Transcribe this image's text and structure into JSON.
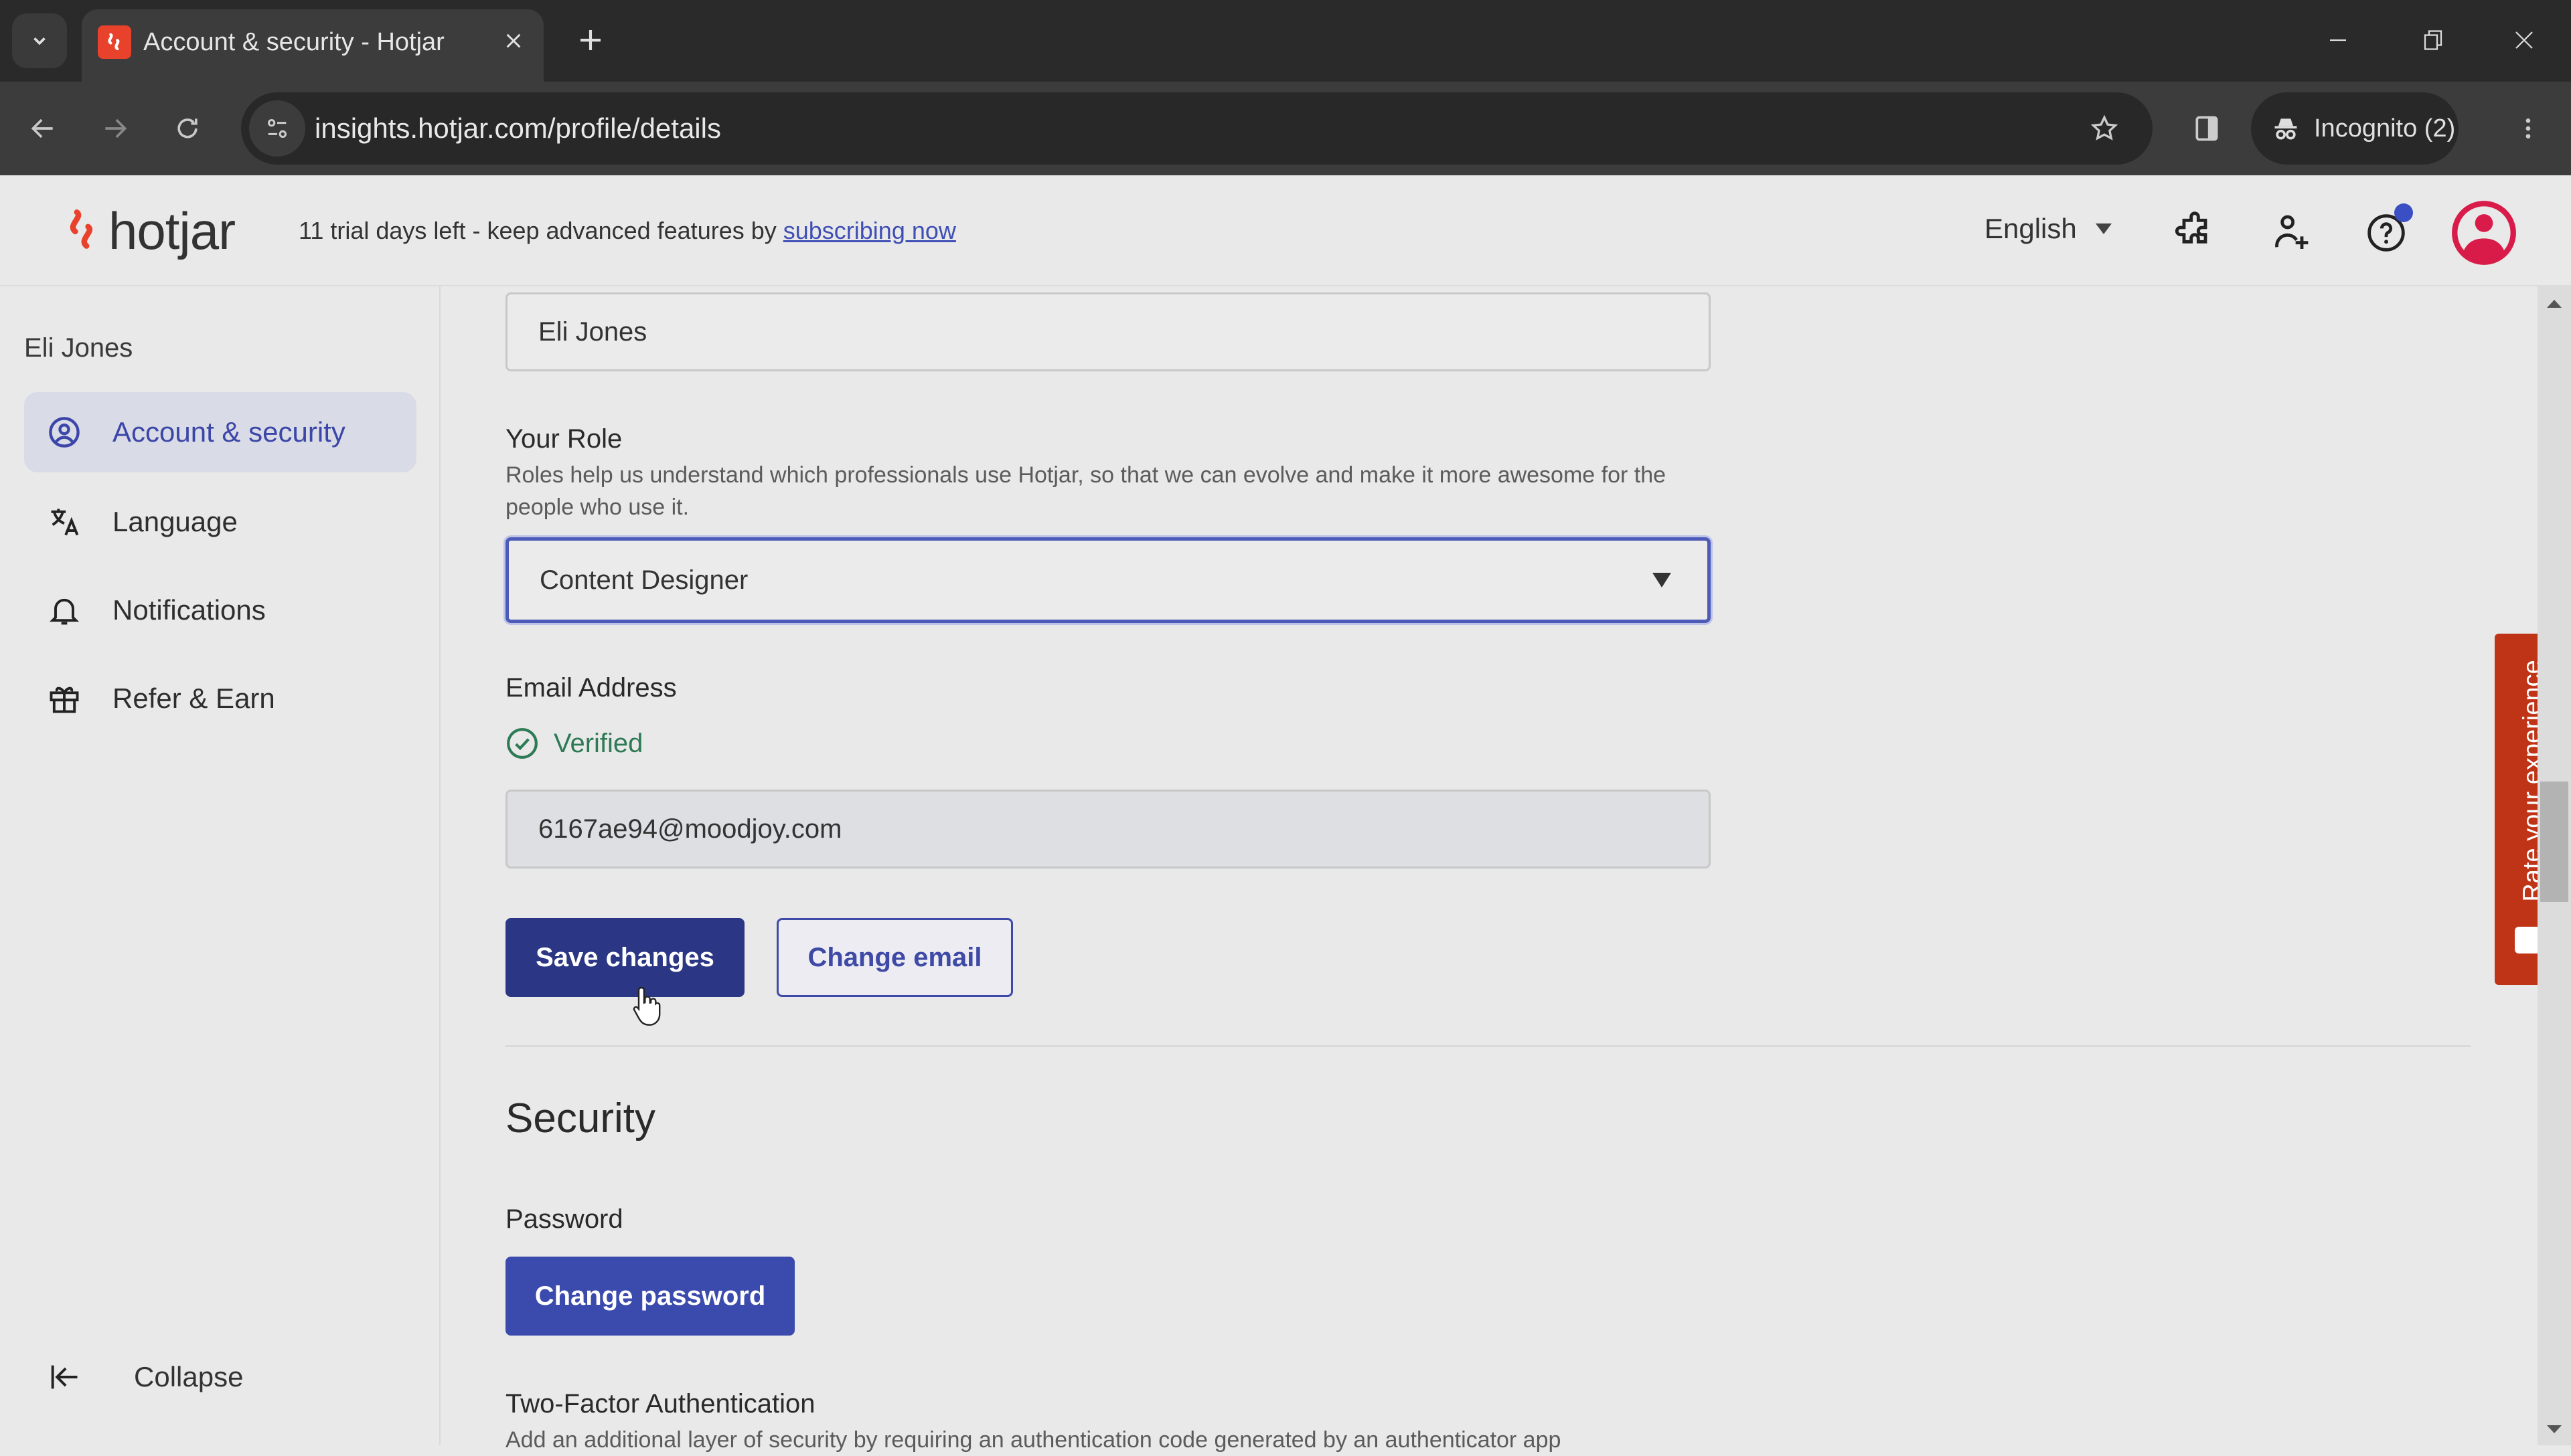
{
  "browser": {
    "tab_title": "Account & security - Hotjar",
    "url": "insights.hotjar.com/profile/details",
    "incognito_label": "Incognito (2)",
    "icons": {
      "tab_search": "chevron-down-icon",
      "favicon": "hotjar-logo-icon",
      "close_tab": "close-icon",
      "new_tab": "plus-icon",
      "back": "arrow-left-icon",
      "forward": "arrow-right-icon",
      "reload": "reload-icon",
      "site_info": "tune-icon",
      "bookmark": "star-icon",
      "side_panel": "side-panel-icon",
      "incognito": "incognito-icon",
      "menu": "more-vertical-icon",
      "minimize": "minimize-icon",
      "restore": "restore-icon",
      "close_window": "close-icon"
    }
  },
  "header": {
    "logo_text": "hotjar",
    "trial_text": "11 trial days left - keep advanced features by ",
    "trial_link": "subscribing now",
    "language": "English",
    "icons": [
      "puzzle-icon",
      "add-user-icon",
      "help-icon",
      "avatar-icon"
    ],
    "help_has_notification": true
  },
  "sidebar": {
    "user_name": "Eli Jones",
    "items": [
      {
        "label": "Account & security",
        "icon": "user-circle-icon",
        "active": true
      },
      {
        "label": "Language",
        "icon": "translate-icon",
        "active": false
      },
      {
        "label": "Notifications",
        "icon": "bell-icon",
        "active": false
      },
      {
        "label": "Refer & Earn",
        "icon": "gift-icon",
        "active": false
      }
    ],
    "collapse_label": "Collapse"
  },
  "form": {
    "name_value": "Eli Jones",
    "role_label": "Your Role",
    "role_description": "Roles help us understand which professionals use Hotjar, so that we can evolve and make it more awesome for the people who use it.",
    "role_value": "Content Designer",
    "email_label": "Email Address",
    "verified_label": "Verified",
    "email_value": "6167ae94@moodjoy.com",
    "save_button": "Save changes",
    "change_email_button": "Change email"
  },
  "security": {
    "title": "Security",
    "password_label": "Password",
    "change_password_button": "Change password",
    "two_factor_label": "Two-Factor Authentication",
    "two_factor_description": "Add an additional layer of security by requiring an authentication code generated by an authenticator app"
  },
  "feedback": {
    "label": "Rate your experience"
  },
  "colors": {
    "brand": "#e8412c",
    "primary_dark": "#2b3684",
    "primary": "#3b4aad",
    "active_text": "#3b46a8",
    "verified": "#2d7a55",
    "avatar": "#d81b48",
    "feedback_tab": "#bf3416"
  }
}
